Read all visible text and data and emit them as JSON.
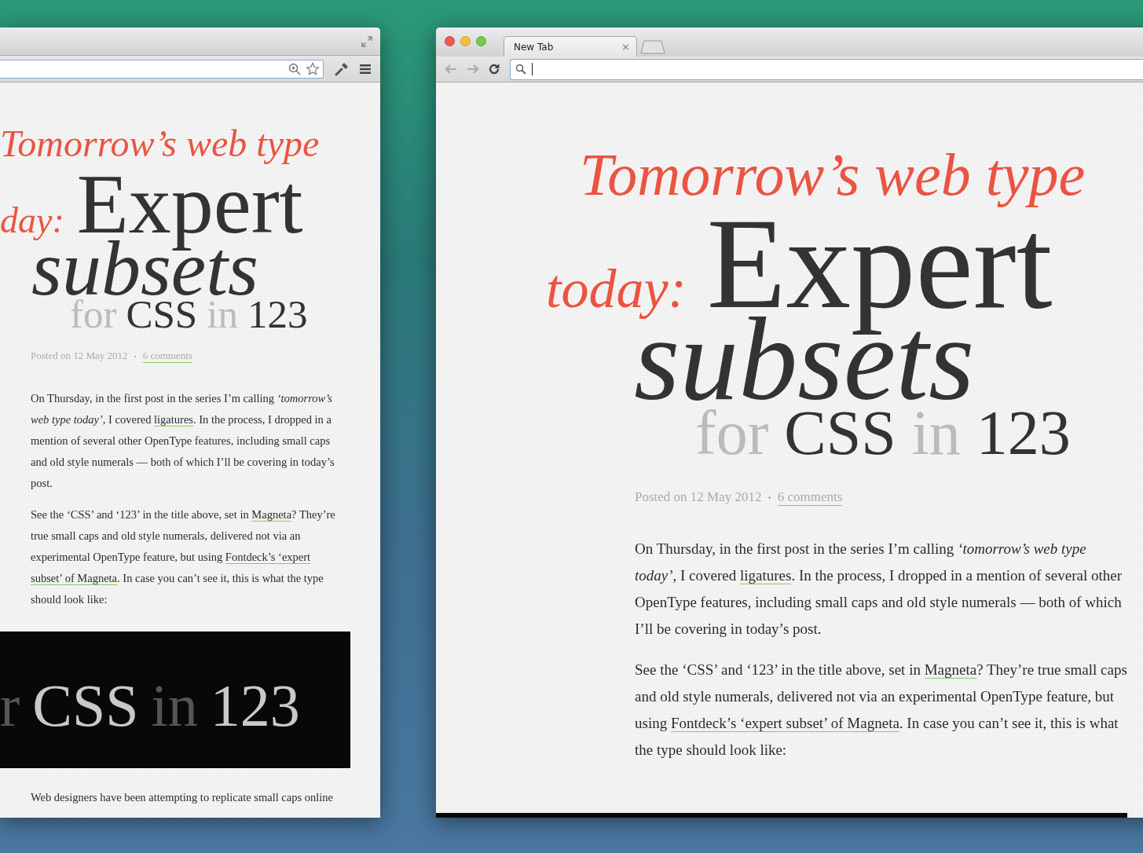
{
  "left_window": {
    "title_lines": [
      [
        {
          "text": "Tomorrow’s web type",
          "kind": "accent"
        }
      ],
      [
        {
          "text": "day:",
          "kind": "accent"
        },
        {
          "text": "Expert",
          "kind": "strong"
        }
      ],
      [
        {
          "text": "subsets",
          "kind": "emphasis"
        }
      ],
      [
        {
          "text": "for",
          "kind": "light"
        },
        {
          "text": "CSS",
          "kind": "strong"
        },
        {
          "text": "in",
          "kind": "light"
        },
        {
          "text": "123",
          "kind": "strong"
        }
      ]
    ],
    "meta": {
      "posted": "Posted on 12 May 2012",
      "separator": "•",
      "comments": "6 comments"
    },
    "paragraphs": [
      [
        {
          "kind": "text",
          "text": "On Thursday, in the first post in the series I’m calling *‘tomorrow’s web type today’*, I covered "
        },
        {
          "kind": "link",
          "text": "ligatures"
        },
        {
          "kind": "text",
          "text": ". In the process, I dropped in a mention of several other OpenType features, including small caps and old style numerals — both of which I’ll be covering in today’s post."
        }
      ],
      [
        {
          "kind": "text",
          "text": "See the ‘CSS’ and ‘123’ in the title above, set in "
        },
        {
          "kind": "link",
          "text": "Magneta"
        },
        {
          "kind": "text",
          "text": "? They’re true small caps and old style numerals, delivered not via an experimental OpenType feature, but using "
        },
        {
          "kind": "link",
          "text": "Fontdeck’s ‘expert"
        },
        {
          "kind": "link",
          "text": "subset’ of Magneta"
        },
        {
          "kind": "text",
          "text": ". In case you can’t see it, this is what the type should look like:"
        }
      ]
    ],
    "type_sample": [
      {
        "text": "r",
        "kind": "light"
      },
      {
        "text": "CSS",
        "kind": "strong"
      },
      {
        "text": "in",
        "kind": "light"
      },
      {
        "text": "123",
        "kind": "strong"
      }
    ],
    "paragraphs_after": [
      [
        {
          "kind": "text",
          "text": "Web designers have been attempting to replicate small caps online"
        }
      ]
    ]
  },
  "right_window": {
    "tab": {
      "label": "New Tab",
      "close": "×",
      "selected": true
    },
    "title_lines": [
      [
        {
          "text": "Tomorrow’s web type",
          "kind": "accent"
        }
      ],
      [
        {
          "text": "today:",
          "kind": "accent"
        },
        {
          "text": "Expert",
          "kind": "strong"
        }
      ],
      [
        {
          "text": "subsets",
          "kind": "emphasis"
        }
      ],
      [
        {
          "text": "for",
          "kind": "light"
        },
        {
          "text": "CSS",
          "kind": "strong"
        },
        {
          "text": "in",
          "kind": "light"
        },
        {
          "text": "123",
          "kind": "strong"
        }
      ]
    ],
    "meta": {
      "posted": "Posted on 12 May 2012",
      "separator": "•",
      "comments": "6 comments"
    },
    "paragraphs": [
      [
        {
          "kind": "text",
          "text": "On Thursday, in the first post in the series I’m calling *‘tomorrow’s web type today’*, I covered "
        },
        {
          "kind": "link",
          "text": "ligatures"
        },
        {
          "kind": "text",
          "text": ". In the process, I dropped in a mention of several other OpenType features, including small caps and old style numerals — both of which I’ll be covering in today’s post."
        }
      ],
      [
        {
          "kind": "text",
          "text": "See the ‘CSS’ and ‘123’ in the title above, set in "
        },
        {
          "kind": "link",
          "text": "Magneta"
        },
        {
          "kind": "text",
          "text": "? They’re true small caps and old style numerals, delivered not via an experimental OpenType feature, but using "
        },
        {
          "kind": "link",
          "text": "Fontdeck’s ‘expert subset’ of Magneta"
        },
        {
          "kind": "text",
          "text": ". In case you can’t see it, this is what the type should look like:"
        }
      ]
    ]
  }
}
